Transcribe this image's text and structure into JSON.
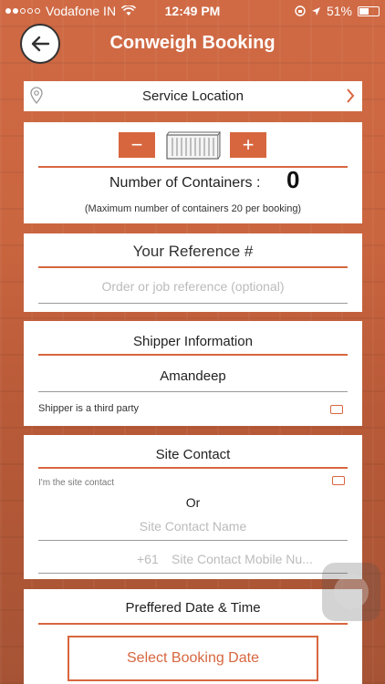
{
  "status_bar": {
    "carrier": "Vodafone IN",
    "time": "12:49 PM",
    "battery": "51%",
    "battery_level": 0.51
  },
  "header": {
    "title": "Conweigh Booking",
    "back_icon": "arrow-left-icon"
  },
  "service_location": {
    "label": "Service Location",
    "pin_icon": "location-pin-icon",
    "chevron_icon": "chevron-right-icon"
  },
  "containers": {
    "minus_label": "−",
    "plus_label": "+",
    "label": "Number of Containers :",
    "value": "0",
    "note": "(Maximum number of containers 20 per booking)"
  },
  "reference": {
    "title": "Your Reference #",
    "placeholder": "Order or job reference (optional)"
  },
  "shipper": {
    "title": "Shipper Information",
    "name": "Amandeep",
    "third_party_label": "Shipper is a third party"
  },
  "site_contact": {
    "title": "Site Contact",
    "me_label": "I'm the site contact",
    "or_text": "Or",
    "name_placeholder": "Site Contact Name",
    "phone_prefix": "+61",
    "mobile_placeholder": "Site Contact Mobile Nu..."
  },
  "date_time": {
    "title": "Preffered Date & Time",
    "button_label": "Select Booking Date"
  },
  "colors": {
    "accent": "#d7663f",
    "background": "#c9653f"
  }
}
